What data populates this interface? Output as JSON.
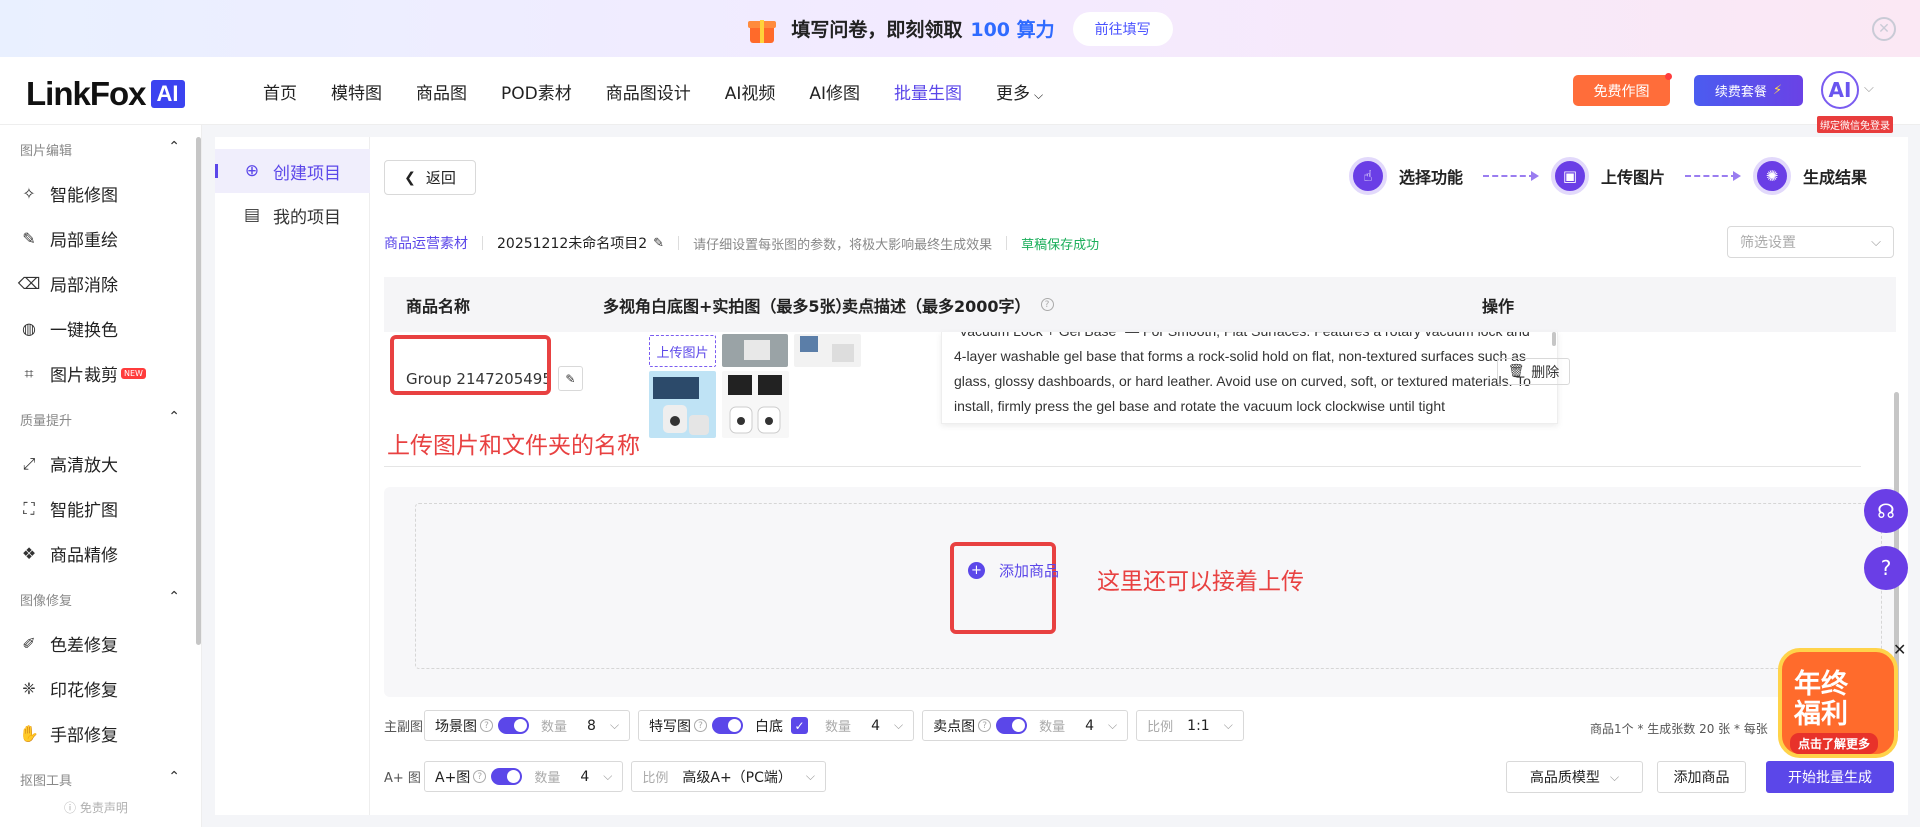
{
  "banner": {
    "text": "填写问卷，即刻领取",
    "highlight": "100 算力",
    "cta": "前往填写",
    "close_icon": "close-circle-icon"
  },
  "nav": {
    "logo_text": "LinkFox",
    "logo_badge": "AI",
    "menu": [
      "首页",
      "模特图",
      "商品图",
      "POD素材",
      "商品图设计",
      "AI视频",
      "AI修图",
      "批量生图",
      "更多"
    ],
    "active_menu": "批量生图",
    "free_btn": "免费作图",
    "renew_btn": "续费套餐",
    "avatar": "AI",
    "bind_tag": "绑定微信免登录"
  },
  "sidebar": {
    "sections": [
      {
        "title": "图片编辑",
        "items": [
          "智能修图",
          "局部重绘",
          "局部消除",
          "一键换色",
          "图片裁剪"
        ]
      },
      {
        "title": "质量提升",
        "items": [
          "高清放大",
          "智能扩图",
          "商品精修"
        ]
      },
      {
        "title": "图像修复",
        "items": [
          "色差修复",
          "印花修复",
          "手部修复"
        ]
      },
      {
        "title": "抠图工具",
        "items": []
      }
    ],
    "new_badge": "NEW",
    "footer": "ⓘ 免责声明"
  },
  "subnav": {
    "items": [
      "创建项目",
      "我的项目"
    ]
  },
  "main": {
    "back": "返回",
    "steps": [
      "选择功能",
      "上传图片",
      "生成结果"
    ],
    "category": "商品运营素材",
    "project_name": "20251212未命名项目2",
    "hint": "请仔细设置每张图的参数，将极大影响最终生成效果",
    "saved": "草稿保存成功",
    "filter_placeholder": "筛选设置",
    "table": {
      "headers": {
        "name": "商品名称",
        "images": "多视角白底图+实拍图（最多5张）",
        "desc": "卖点描述（最多2000字）",
        "ops": "操作"
      },
      "row": {
        "name": "Group 2147205495",
        "upload_tag": "上传图片",
        "desc": "\"Vacuum Lock + Gel Base\" — For Smooth, Flat Surfaces: Features a rotary vacuum lock and 4-layer washable gel base that forms a rock-solid hold on flat, non-textured surfaces such as glass, glossy dashboards, or hard leather. Avoid use on curved, soft, or textured materials. To install, firmly press the gel base and rotate the vacuum lock clockwise until tight",
        "delete": "删除"
      }
    },
    "annotation_name": "上传图片和文件夹的名称",
    "add_product": "添加商品",
    "annotation_add": "这里还可以接着上传",
    "options": {
      "main_label": "主副图",
      "scene": {
        "label": "场景图",
        "qty_label": "数量",
        "qty": "8"
      },
      "closeup": {
        "label": "特写图",
        "white": "白底",
        "qty_label": "数量",
        "qty": "4"
      },
      "selling": {
        "label": "卖点图",
        "qty_label": "数量",
        "qty": "4"
      },
      "ratio": {
        "label": "比例",
        "value": "1:1"
      },
      "aplus_label": "A+ 图",
      "aplus": {
        "label": "A+图",
        "qty_label": "数量",
        "qty": "4"
      },
      "aplus_ratio": {
        "label": "比例",
        "value": "高级A+（PC端）"
      }
    },
    "summary": "商品1个 * 生成张数 20 张 * 每张",
    "model_btn": "高品质模型",
    "add_btn": "添加商品",
    "start_btn": "开始批量生成"
  },
  "promo": {
    "line1": "年终",
    "line2": "福利",
    "cta": "点击了解更多"
  },
  "colors": {
    "accent": "#5b47e9",
    "annotation": "#e84141",
    "free": "#ff6d3a"
  }
}
